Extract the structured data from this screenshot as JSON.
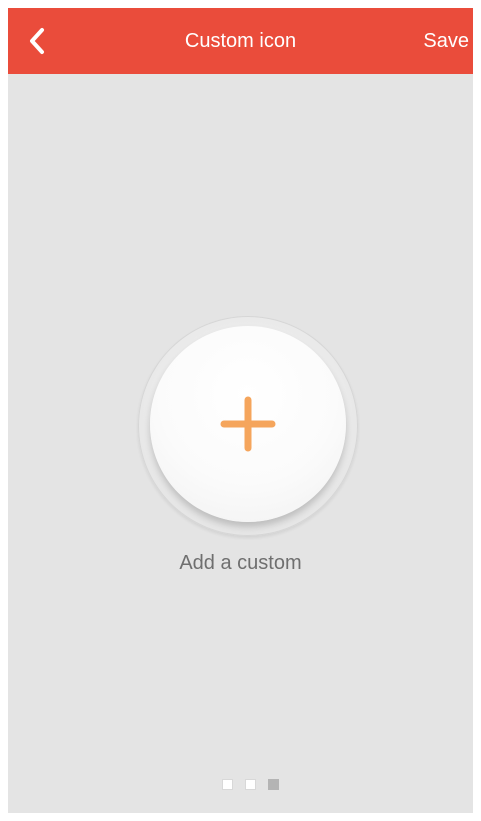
{
  "header": {
    "title": "Custom icon",
    "save_label": "Save",
    "back_icon": "chevron-left-icon",
    "background_color": "#ea4c3b"
  },
  "main": {
    "add_label": "Add a custom",
    "add_icon": "plus-icon",
    "plus_color": "#f5a55c"
  },
  "pager": {
    "total": 3,
    "active_index": 2
  }
}
